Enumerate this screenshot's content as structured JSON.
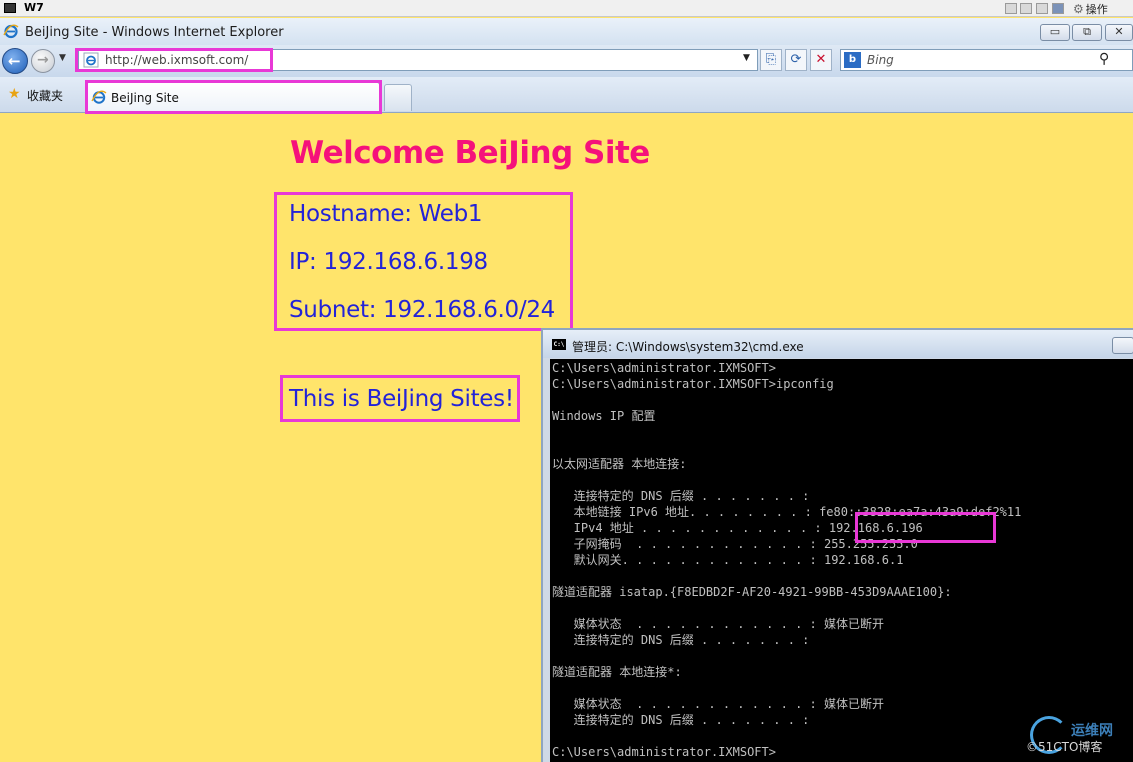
{
  "vm": {
    "title": "W7",
    "actions_label": "操作"
  },
  "window": {
    "title": "BeiJing Site - Windows Internet Explorer",
    "min": "▭",
    "max": "⧉",
    "close": "✕"
  },
  "nav": {
    "back_glyph": "←",
    "forward_glyph": "→",
    "url": "http://web.ixmsoft.com/",
    "search_placeholder": "Bing",
    "search_engine_letter": "b"
  },
  "tabs": {
    "favorites_label": "收藏夹",
    "active_tab_label": "BeiJing Site"
  },
  "page": {
    "heading": "Welcome BeiJing Site",
    "hostname": "Hostname: Web1",
    "ip": "IP: 192.168.6.198",
    "subnet": "Subnet: 192.168.6.0/24",
    "sites_message": "This is BeiJing Sites!"
  },
  "cmd": {
    "title": "管理员: C:\\Windows\\system32\\cmd.exe",
    "lines": [
      "C:\\Users\\administrator.IXMSOFT>",
      "C:\\Users\\administrator.IXMSOFT>ipconfig",
      "",
      "Windows IP 配置",
      "",
      "",
      "以太网适配器 本地连接:",
      "",
      "   连接特定的 DNS 后缀 . . . . . . . :",
      "   本地链接 IPv6 地址. . . . . . . . : fe80::3828:ea7a:43a9:def2%11",
      "   IPv4 地址 . . . . . . . . . . . . : 192.168.6.196",
      "   子网掩码  . . . . . . . . . . . . : 255.255.255.0",
      "   默认网关. . . . . . . . . . . . . : 192.168.6.1",
      "",
      "隧道适配器 isatap.{F8EDBD2F-AF20-4921-99BB-453D9AAAE100}:",
      "",
      "   媒体状态  . . . . . . . . . . . . : 媒体已断开",
      "   连接特定的 DNS 后缀 . . . . . . . :",
      "",
      "隧道适配器 本地连接*:",
      "",
      "   媒体状态  . . . . . . . . . . . . : 媒体已断开",
      "   连接特定的 DNS 后缀 . . . . . . . :",
      "",
      "C:\\Users\\administrator.IXMSOFT>"
    ]
  },
  "watermark": {
    "line1": "运维网",
    "line2": "©51CTO博客"
  },
  "colors": {
    "page_bg": "#ffe46b",
    "heading": "#f5127b",
    "info_text": "#2323d8",
    "highlight": "#e838d6"
  }
}
